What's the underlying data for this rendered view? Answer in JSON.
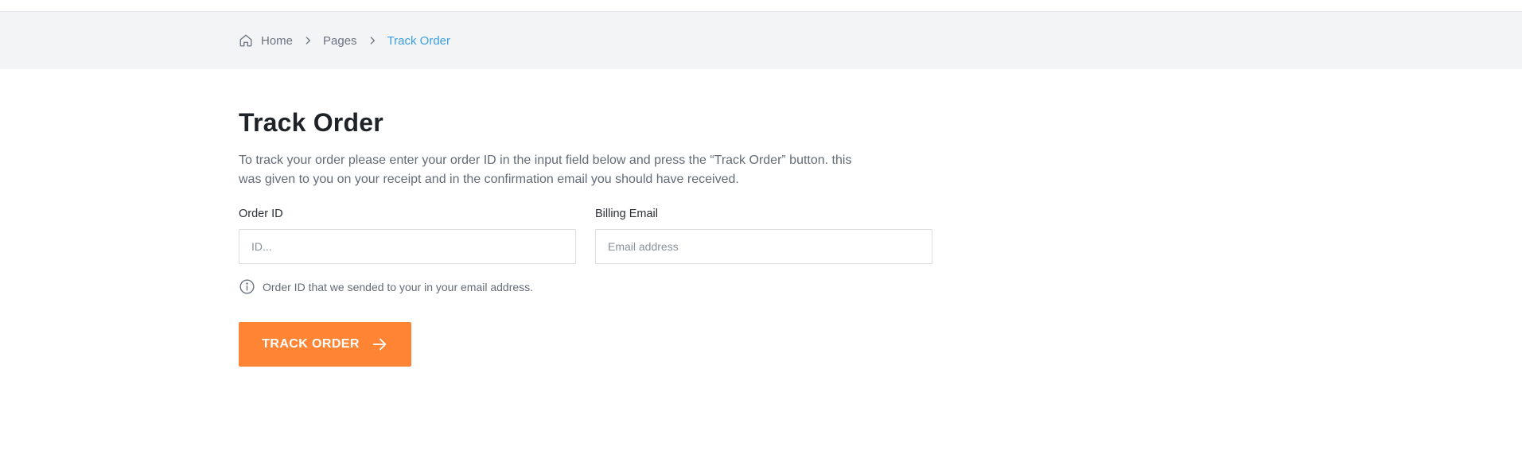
{
  "breadcrumb": {
    "items": [
      {
        "label": "Home",
        "icon": "home-icon"
      },
      {
        "label": "Pages"
      },
      {
        "label": "Track Order",
        "current": true
      }
    ]
  },
  "page": {
    "title": "Track Order",
    "description": "To track your order please enter your order ID in the input field below and press the “Track Order” button. this was given to you on your receipt and in the confirmation email you should have received."
  },
  "form": {
    "order_id": {
      "label": "Order ID",
      "placeholder": "ID...",
      "value": ""
    },
    "billing_email": {
      "label": "Billing Email",
      "placeholder": "Email address",
      "value": ""
    },
    "hint": "Order ID that we sended to your in your email address.",
    "submit_label": "TRACK ORDER"
  },
  "colors": {
    "accent": "#ff8534",
    "link_active": "#3a9fe0",
    "breadcrumb_bg": "#f3f4f6"
  }
}
